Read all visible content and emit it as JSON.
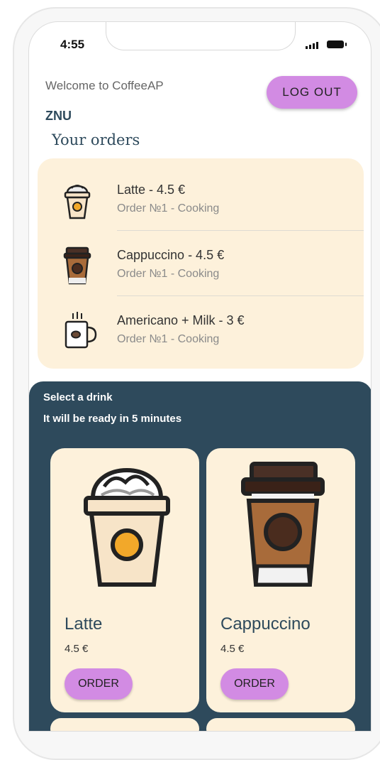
{
  "status_bar": {
    "time": "4:55"
  },
  "header": {
    "welcome": "Welcome to CoffeeAP",
    "logout_label": "LOG OUT",
    "username": "ZNU"
  },
  "orders": {
    "title": "Your orders",
    "items": [
      {
        "name": "Latte - 4.5 €",
        "status": "Order №1 - Cooking",
        "icon": "latte-cup-icon"
      },
      {
        "name": "Cappuccino - 4.5 €",
        "status": "Order №1 - Cooking",
        "icon": "cappuccino-cup-icon"
      },
      {
        "name": "Americano + Milk - 3 €",
        "status": "Order №1 - Cooking",
        "icon": "americano-mug-icon"
      }
    ]
  },
  "menu": {
    "heading": "Select a drink",
    "subheading": "It will be ready in 5 minutes",
    "drinks": [
      {
        "name": "Latte",
        "price": "4.5 €",
        "order_label": "ORDER",
        "icon": "latte-cup-icon"
      },
      {
        "name": "Cappuccino",
        "price": "4.5 €",
        "order_label": "ORDER",
        "icon": "cappuccino-cup-icon"
      }
    ]
  },
  "colors": {
    "accent": "#d28be3",
    "navy": "#2e4a5c",
    "cream": "#fdf1db"
  }
}
